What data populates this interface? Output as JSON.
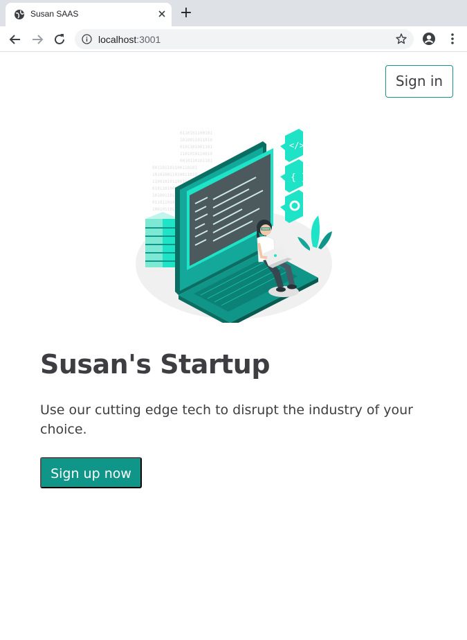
{
  "browser": {
    "tab_title": "Susan SAAS",
    "new_tab_label": "+",
    "url_host": "localhost",
    "url_port": ":3001"
  },
  "header": {
    "signin_label": "Sign in"
  },
  "hero": {
    "title": "Susan's Startup",
    "subtitle": "Use our cutting edge tech to disrupt the industry of your choice.",
    "signup_label": "Sign up now",
    "illustration": "developer-laptop-illustration"
  },
  "colors": {
    "accent": "#0f9688",
    "accent_light": "#1ee3c7",
    "text": "#3d3d42",
    "outline": "#1c8f8a"
  }
}
